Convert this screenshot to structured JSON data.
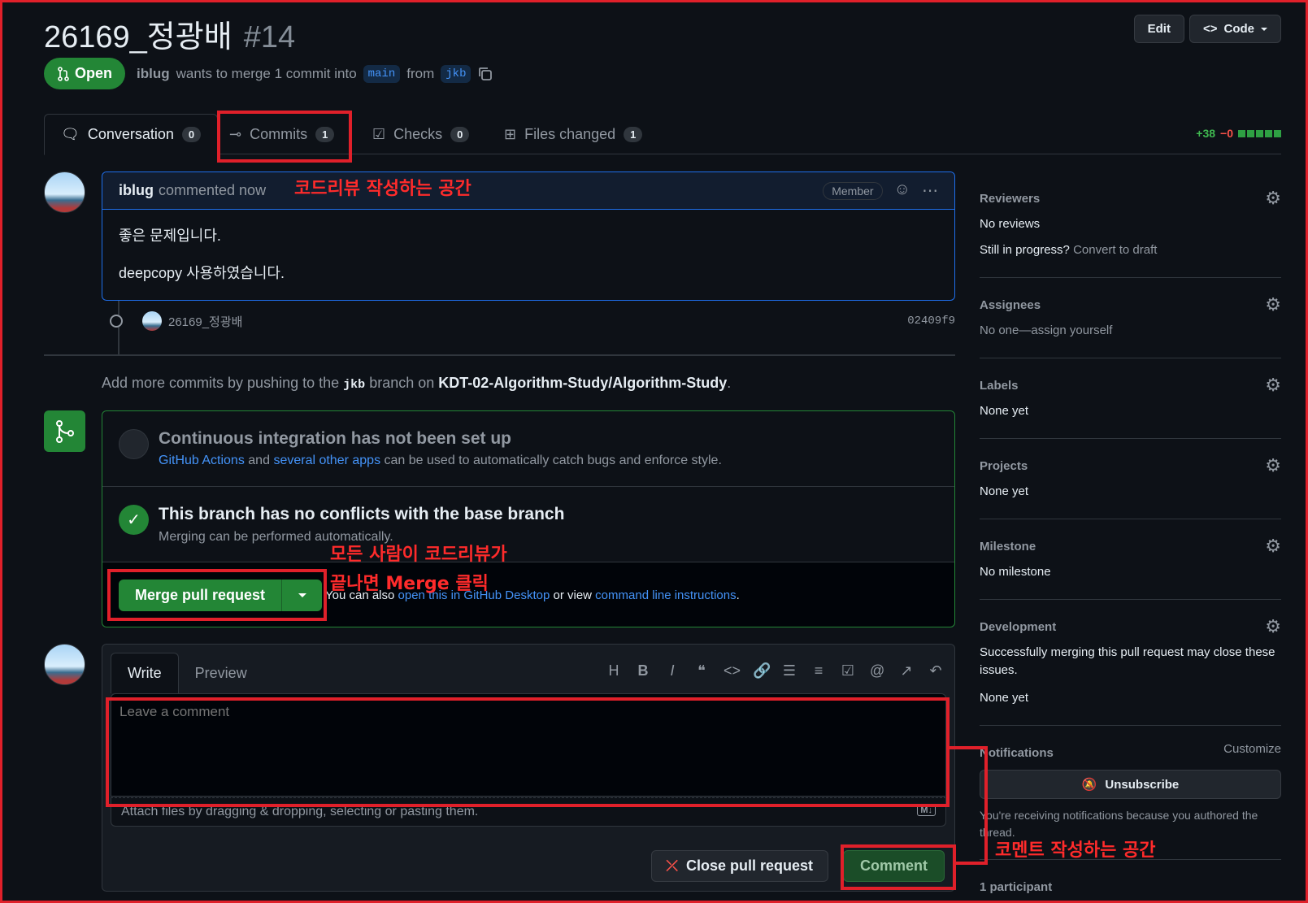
{
  "pr": {
    "title": "26169_정광배",
    "number": "#14",
    "state": "Open",
    "author": "iblug",
    "merge_text": "wants to merge 1 commit into",
    "base": "main",
    "from_word": "from",
    "head": "jkb"
  },
  "header_buttons": {
    "edit": "Edit",
    "code": "Code"
  },
  "tabs": [
    {
      "label": "Conversation",
      "count": "0"
    },
    {
      "label": "Commits",
      "count": "1"
    },
    {
      "label": "Checks",
      "count": "0"
    },
    {
      "label": "Files changed",
      "count": "1"
    }
  ],
  "diffstat": {
    "additions": "+38",
    "deletions": "−0"
  },
  "comment": {
    "author": "iblug",
    "action": "commented now",
    "badge": "Member",
    "body": [
      "좋은 문제입니다.",
      "deepcopy 사용하였습니다."
    ]
  },
  "commit": {
    "message": "26169_정광배",
    "sha": "02409f9"
  },
  "hint": {
    "prefix": "Add more commits by pushing to the",
    "branch": "jkb",
    "middle": "branch on",
    "repo": "KDT-02-Algorithm-Study/Algorithm-Study",
    "suffix": "."
  },
  "ci": {
    "title": "Continuous integration has not been set up",
    "link1": "GitHub Actions",
    "and": "and",
    "link2": "several other apps",
    "rest": "can be used to automatically catch bugs and enforce style."
  },
  "conflicts": {
    "title": "This branch has no conflicts with the base branch",
    "sub": "Merging can be performed automatically."
  },
  "merge": {
    "button": "Merge pull request",
    "also": "You can also",
    "link1": "open this in GitHub Desktop",
    "or": "or view",
    "link2": "command line instructions",
    "end": "."
  },
  "editor": {
    "write": "Write",
    "preview": "Preview",
    "placeholder": "Leave a comment",
    "attach": "Attach files by dragging & dropping, selecting or pasting them.",
    "close_button": "Close pull request",
    "comment_button": "Comment"
  },
  "sidebar": {
    "reviewers": {
      "label": "Reviewers",
      "value": "No reviews",
      "progress": "Still in progress?",
      "draft": "Convert to draft"
    },
    "assignees": {
      "label": "Assignees",
      "value": "No one—",
      "assign": "assign yourself"
    },
    "labels": {
      "label": "Labels",
      "value": "None yet"
    },
    "projects": {
      "label": "Projects",
      "value": "None yet"
    },
    "milestone": {
      "label": "Milestone",
      "value": "No milestone"
    },
    "development": {
      "label": "Development",
      "note": "Successfully merging this pull request may close these issues.",
      "value": "None yet"
    },
    "notifications": {
      "label": "Notifications",
      "customize": "Customize",
      "unsubscribe": "Unsubscribe",
      "note": "You're receiving notifications because you authored the thread."
    },
    "participants": "1 participant"
  },
  "annotations": {
    "code_review": "코드리뷰 작성하는 공간",
    "merge_line1": "모든 사람이 코드리뷰가",
    "merge_line2": "끝나면 Merge 클릭",
    "comment_space": "코멘트 작성하는 공간"
  },
  "colors": {
    "accent_red": "#e0202a",
    "green": "#238636",
    "link": "#4493f8"
  }
}
